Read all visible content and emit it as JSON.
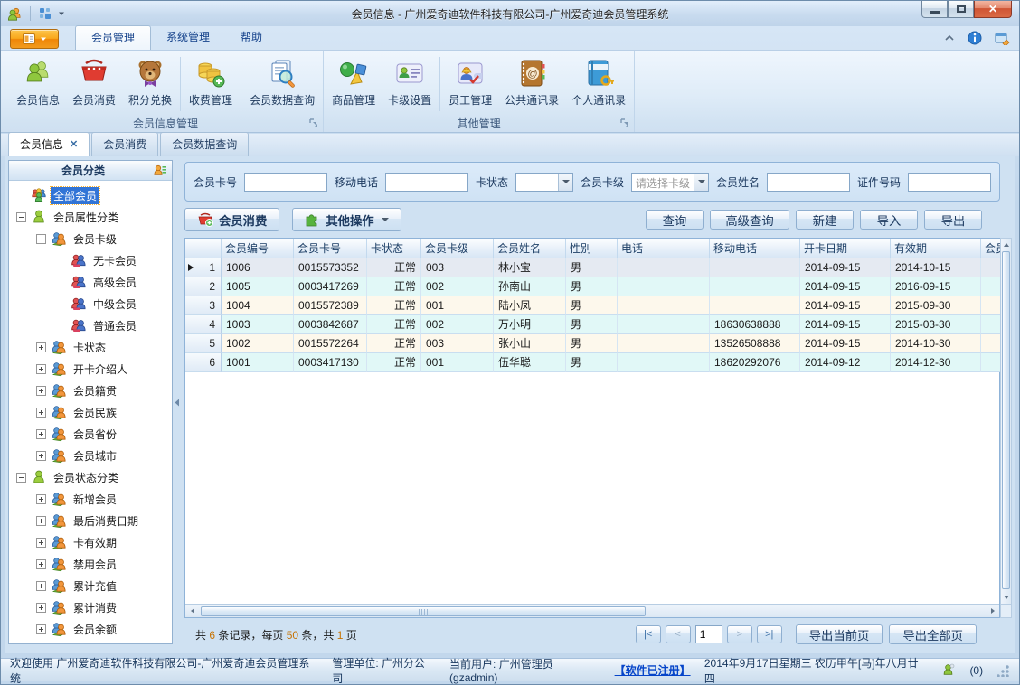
{
  "colors": {
    "selection_blue": "#3174d6",
    "accent_orange": "#f49a0b",
    "row_cream": "#fdf8ec",
    "row_cyan": "#e1f8f7",
    "current_row": "#e5eaf2",
    "number_highlight": "#c77405"
  },
  "window": {
    "title": "会员信息 - 广州爱奇迪软件科技有限公司-广州爱奇迪会员管理系统"
  },
  "ribbon": {
    "tabs": [
      {
        "label": "会员管理",
        "active": true
      },
      {
        "label": "系统管理",
        "active": false
      },
      {
        "label": "帮助",
        "active": false
      }
    ],
    "groups": [
      {
        "label": "会员信息管理",
        "buttons": [
          {
            "label": "会员信息",
            "icon": "members",
            "sep_after": false
          },
          {
            "label": "会员消费",
            "icon": "basket",
            "sep_after": false
          },
          {
            "label": "积分兑换",
            "icon": "bear",
            "sep_after": true
          },
          {
            "label": "收费管理",
            "icon": "coins",
            "sep_after": true
          },
          {
            "label": "会员数据查询",
            "icon": "doc-search",
            "sep_after": false
          }
        ]
      },
      {
        "label": "其他管理",
        "buttons": [
          {
            "label": "商品管理",
            "icon": "shapes",
            "sep_after": false
          },
          {
            "label": "卡级设置",
            "icon": "card",
            "sep_after": true
          },
          {
            "label": "员工管理",
            "icon": "staff",
            "sep_after": false
          },
          {
            "label": "公共通讯录",
            "icon": "address-book",
            "sep_after": false
          },
          {
            "label": "个人通讯录",
            "icon": "personal-book",
            "sep_after": false
          }
        ]
      }
    ]
  },
  "doc_tabs": [
    {
      "label": "会员信息",
      "active": true,
      "closable": true
    },
    {
      "label": "会员消费",
      "active": false,
      "closable": false
    },
    {
      "label": "会员数据查询",
      "active": false,
      "closable": false
    }
  ],
  "sidebar": {
    "header": "会员分类",
    "tree": [
      {
        "label": "全部会员",
        "level": 0,
        "icon": "group",
        "expander": "none",
        "selected": true
      },
      {
        "label": "会员属性分类",
        "level": 0,
        "icon": "person-green",
        "expander": "minus",
        "selected": false
      },
      {
        "label": "会员卡级",
        "level": 1,
        "icon": "person-duo-orange",
        "expander": "minus",
        "selected": false
      },
      {
        "label": "无卡会员",
        "level": 2,
        "icon": "person-duo-red",
        "expander": "none",
        "selected": false
      },
      {
        "label": "高级会员",
        "level": 2,
        "icon": "person-duo-red",
        "expander": "none",
        "selected": false
      },
      {
        "label": "中级会员",
        "level": 2,
        "icon": "person-duo-red",
        "expander": "none",
        "selected": false
      },
      {
        "label": "普通会员",
        "level": 2,
        "icon": "person-duo-red",
        "expander": "none",
        "selected": false
      },
      {
        "label": "卡状态",
        "level": 1,
        "icon": "person-duo-orange",
        "expander": "plus",
        "selected": false
      },
      {
        "label": "开卡介绍人",
        "level": 1,
        "icon": "person-duo-orange",
        "expander": "plus",
        "selected": false
      },
      {
        "label": "会员籍贯",
        "level": 1,
        "icon": "person-duo-orange",
        "expander": "plus",
        "selected": false
      },
      {
        "label": "会员民族",
        "level": 1,
        "icon": "person-duo-orange",
        "expander": "plus",
        "selected": false
      },
      {
        "label": "会员省份",
        "level": 1,
        "icon": "person-duo-orange",
        "expander": "plus",
        "selected": false
      },
      {
        "label": "会员城市",
        "level": 1,
        "icon": "person-duo-orange",
        "expander": "plus",
        "selected": false
      },
      {
        "label": "会员状态分类",
        "level": 0,
        "icon": "person-green",
        "expander": "minus",
        "selected": false
      },
      {
        "label": "新增会员",
        "level": 1,
        "icon": "person-duo-orange",
        "expander": "plus",
        "selected": false
      },
      {
        "label": "最后消费日期",
        "level": 1,
        "icon": "person-duo-orange",
        "expander": "plus",
        "selected": false
      },
      {
        "label": "卡有效期",
        "level": 1,
        "icon": "person-duo-orange",
        "expander": "plus",
        "selected": false
      },
      {
        "label": "禁用会员",
        "level": 1,
        "icon": "person-duo-orange",
        "expander": "plus",
        "selected": false
      },
      {
        "label": "累计充值",
        "level": 1,
        "icon": "person-duo-orange",
        "expander": "plus",
        "selected": false
      },
      {
        "label": "累计消费",
        "level": 1,
        "icon": "person-duo-orange",
        "expander": "plus",
        "selected": false
      },
      {
        "label": "会员余额",
        "level": 1,
        "icon": "person-duo-orange",
        "expander": "plus",
        "selected": false
      }
    ]
  },
  "filters": [
    {
      "label": "会员卡号",
      "type": "text",
      "value": ""
    },
    {
      "label": "移动电话",
      "type": "text",
      "value": ""
    },
    {
      "label": "卡状态",
      "type": "combo",
      "value": "",
      "placeholder": false
    },
    {
      "label": "会员卡级",
      "type": "combo",
      "value": "请选择卡级",
      "placeholder": true
    },
    {
      "label": "会员姓名",
      "type": "text",
      "value": ""
    },
    {
      "label": "证件号码",
      "type": "text",
      "value": ""
    }
  ],
  "toolbar": {
    "left": [
      {
        "label": "会员消费",
        "icon": "basket-add",
        "dropdown": false
      },
      {
        "label": "其他操作",
        "icon": "puzzle",
        "dropdown": true
      }
    ],
    "right": [
      "查询",
      "高级查询",
      "新建",
      "导入",
      "导出"
    ]
  },
  "table": {
    "columns": [
      "会员编号",
      "会员卡号",
      "卡状态",
      "会员卡级",
      "会员姓名",
      "性别",
      "电话",
      "移动电话",
      "开卡日期",
      "有效期",
      "会员"
    ],
    "rows": [
      {
        "num": "1",
        "current": true,
        "cells": [
          "1006",
          "0015573352",
          "正常",
          "003",
          "林小宝",
          "男",
          "",
          "",
          "2014-09-15",
          "2014-10-15",
          ""
        ]
      },
      {
        "num": "2",
        "current": false,
        "cells": [
          "1005",
          "0003417269",
          "正常",
          "002",
          "孙南山",
          "男",
          "",
          "",
          "2014-09-15",
          "2016-09-15",
          ""
        ]
      },
      {
        "num": "3",
        "current": false,
        "cells": [
          "1004",
          "0015572389",
          "正常",
          "001",
          "陆小凤",
          "男",
          "",
          "",
          "2014-09-15",
          "2015-09-30",
          ""
        ]
      },
      {
        "num": "4",
        "current": false,
        "cells": [
          "1003",
          "0003842687",
          "正常",
          "002",
          "万小明",
          "男",
          "",
          "18630638888",
          "2014-09-15",
          "2015-03-30",
          ""
        ]
      },
      {
        "num": "5",
        "current": false,
        "cells": [
          "1002",
          "0015572264",
          "正常",
          "003",
          "张小山",
          "男",
          "",
          "13526508888",
          "2014-09-15",
          "2014-10-30",
          ""
        ]
      },
      {
        "num": "6",
        "current": false,
        "cells": [
          "1001",
          "0003417130",
          "正常",
          "001",
          "伍华聪",
          "男",
          "",
          "18620292076",
          "2014-09-12",
          "2014-12-30",
          ""
        ]
      }
    ]
  },
  "pagination": {
    "summary_parts": [
      {
        "text": "共 ",
        "num": false
      },
      {
        "text": "6",
        "num": true
      },
      {
        "text": " 条记录，每页 ",
        "num": false
      },
      {
        "text": "50",
        "num": true
      },
      {
        "text": " 条，共 ",
        "num": false
      },
      {
        "text": "1",
        "num": true
      },
      {
        "text": " 页",
        "num": false
      }
    ],
    "nav": [
      "|<",
      "<",
      ">",
      ">|"
    ],
    "nav_disabled": [
      false,
      true,
      true,
      false
    ],
    "page_value": "1",
    "export_buttons": [
      "导出当前页",
      "导出全部页"
    ]
  },
  "statusbar": {
    "welcome": "欢迎使用 广州爱奇迪软件科技有限公司-广州爱奇迪会员管理系统",
    "org": "管理单位: 广州分公司",
    "user": "当前用户: 广州管理员(gzadmin)",
    "register_link": "【软件已注册】",
    "date_text": "2014年9月17日星期三 农历甲午[马]年八月廿四",
    "msg_count": "(0)"
  }
}
